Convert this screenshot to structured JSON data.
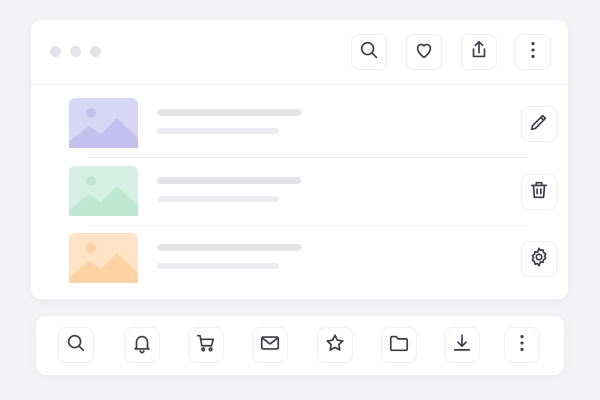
{
  "window": {
    "controls": [
      "dot",
      "dot",
      "dot"
    ]
  },
  "header": {
    "actions": [
      {
        "icon": "search-icon"
      },
      {
        "icon": "heart-icon"
      },
      {
        "icon": "share-icon"
      },
      {
        "icon": "more-vertical-icon"
      }
    ]
  },
  "list": {
    "items": [
      {
        "thumbnail_color": "#d8d6f5",
        "thumbnail_art_color": "#c3c0ee",
        "action_icon": "pencil-icon"
      },
      {
        "thumbnail_color": "#d4efe3",
        "thumbnail_art_color": "#bde6d3",
        "action_icon": "trash-icon"
      },
      {
        "thumbnail_color": "#ffe3c6",
        "thumbnail_art_color": "#ffd3a4",
        "action_icon": "gear-icon"
      }
    ]
  },
  "toolbar": {
    "icons": [
      "search-icon",
      "bell-icon",
      "cart-icon",
      "mail-icon",
      "star-icon",
      "folder-icon",
      "download-icon",
      "more-vertical-icon"
    ]
  },
  "colors": {
    "background": "#f4f4f7",
    "card": "#ffffff",
    "icon_stroke": "#3a3a45",
    "placeholder_line": "#e3e3e8"
  }
}
